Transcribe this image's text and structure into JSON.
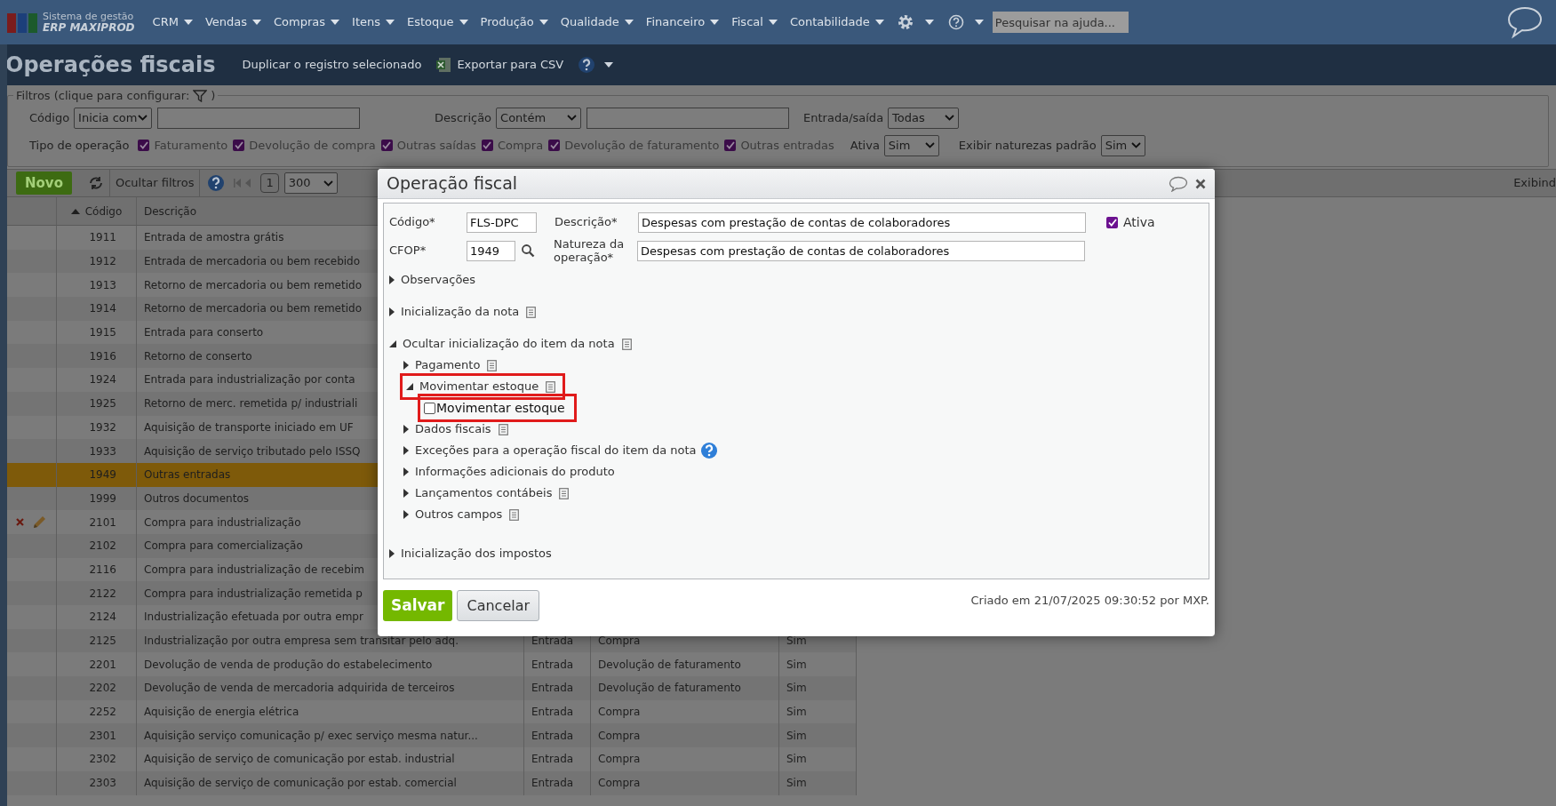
{
  "nav": {
    "logo_line1": "Sistema de gestão",
    "logo_line2": "ERP MAXIPROD",
    "menus": [
      "CRM",
      "Vendas",
      "Compras",
      "Itens",
      "Estoque",
      "Produção",
      "Qualidade",
      "Financeiro",
      "Fiscal",
      "Contabilidade"
    ],
    "search_placeholder": "Pesquisar na ajuda..."
  },
  "page": {
    "title": "Operações fiscais",
    "actions": [
      {
        "kind": "link",
        "label": "Duplicar o registro selecionado"
      },
      {
        "kind": "csv",
        "label": "Exportar para CSV"
      }
    ]
  },
  "filters": {
    "legend": "Filtros (clique para configurar:",
    "legend_end": ")",
    "row1": [
      {
        "label": "Código",
        "select": "Inicia com",
        "input": true
      },
      {
        "label": "Descrição",
        "select": "Contém",
        "input": true
      },
      {
        "label": "Entrada/saída",
        "select": "Todas",
        "input": false
      }
    ],
    "type_label": "Tipo de operação",
    "types": [
      {
        "label": "Faturamento",
        "checked": true
      },
      {
        "label": "Devolução de compra",
        "checked": true
      },
      {
        "label": "Outras saídas",
        "checked": true
      },
      {
        "label": "Compra",
        "checked": true
      },
      {
        "label": "Devolução de faturamento",
        "checked": true
      },
      {
        "label": "Outras entradas",
        "checked": true
      }
    ],
    "row2": [
      {
        "label": "Ativa",
        "select": "Sim"
      },
      {
        "label": "Exibir naturezas padrão",
        "select": "Sim"
      }
    ]
  },
  "toolbar": {
    "new": "Novo",
    "hide_filters": "Ocultar filtros",
    "page": "1",
    "per_page": "300",
    "showing": "Exibind"
  },
  "table": {
    "columns": [
      {
        "label": "Código",
        "sorted": true
      },
      {
        "label": "Descrição",
        "sorted": false
      }
    ],
    "rows": [
      {
        "code": "1911",
        "description": "Entrada de amostra grátis",
        "selected": false,
        "row_actions": false
      },
      {
        "code": "1912",
        "description": "Entrada de mercadoria ou bem recebido",
        "selected": false,
        "row_actions": false
      },
      {
        "code": "1913",
        "description": "Retorno de mercadoria ou bem remetido",
        "selected": false,
        "row_actions": false
      },
      {
        "code": "1914",
        "description": "Retorno de mercadoria ou bem remetido",
        "selected": false,
        "row_actions": false
      },
      {
        "code": "1915",
        "description": "Entrada para conserto",
        "selected": false,
        "row_actions": false
      },
      {
        "code": "1916",
        "description": "Retorno de conserto",
        "selected": false,
        "row_actions": false
      },
      {
        "code": "1924",
        "description": "Entrada para industrialização por conta",
        "selected": false,
        "row_actions": false
      },
      {
        "code": "1925",
        "description": "Retorno de merc. remetida p/ industriali",
        "selected": false,
        "row_actions": false
      },
      {
        "code": "1932",
        "description": "Aquisição de transporte iniciado em UF",
        "selected": false,
        "row_actions": false
      },
      {
        "code": "1933",
        "description": "Aquisição de serviço tributado pelo ISSQ",
        "selected": false,
        "row_actions": false
      },
      {
        "code": "1949",
        "description": "Outras entradas",
        "selected": true,
        "row_actions": false
      },
      {
        "code": "1999",
        "description": "Outros documentos",
        "selected": false,
        "row_actions": false
      },
      {
        "code": "2101",
        "description": "Compra para industrialização",
        "selected": false,
        "row_actions": true
      },
      {
        "code": "2102",
        "description": "Compra para comercialização",
        "selected": false,
        "row_actions": false
      },
      {
        "code": "2116",
        "description": "Compra para industrialização de recebim",
        "selected": false,
        "row_actions": false
      },
      {
        "code": "2122",
        "description": "Compra para industrialização remetida p",
        "selected": false,
        "row_actions": false
      },
      {
        "code": "2124",
        "description": "Industrialização efetuada por outra empr",
        "selected": false,
        "row_actions": false
      },
      {
        "code": "2125",
        "description": "Industrialização por outra empresa sem transitar pelo adq.",
        "column_3": "Entrada",
        "column_4": "Compra",
        "column_5": "Sim",
        "selected": false,
        "row_actions": false
      },
      {
        "code": "2201",
        "description": "Devolução de venda de produção do estabelecimento",
        "column_3": "Entrada",
        "column_4": "Devolução de faturamento",
        "column_5": "Sim",
        "selected": false,
        "row_actions": false
      },
      {
        "code": "2202",
        "description": "Devolução de venda de mercadoria adquirida de terceiros",
        "column_3": "Entrada",
        "column_4": "Devolução de faturamento",
        "column_5": "Sim",
        "selected": false,
        "row_actions": false
      },
      {
        "code": "2252",
        "description": "Aquisição de energia elétrica",
        "column_3": "Entrada",
        "column_4": "Compra",
        "column_5": "Sim",
        "selected": false,
        "row_actions": false
      },
      {
        "code": "2301",
        "description": "Aquisição serviço comunicação p/ exec serviço mesma natur...",
        "column_3": "Entrada",
        "column_4": "Compra",
        "column_5": "Sim",
        "selected": false,
        "row_actions": false
      },
      {
        "code": "2302",
        "description": "Aquisição de serviço de comunicação por estab. industrial",
        "column_3": "Entrada",
        "column_4": "Compra",
        "column_5": "Sim",
        "selected": false,
        "row_actions": false
      },
      {
        "code": "2303",
        "description": "Aquisição de serviço de comunicação por estab. comercial",
        "column_3": "Entrada",
        "column_4": "Compra",
        "column_5": "Sim",
        "selected": false,
        "row_actions": false
      }
    ]
  },
  "modal": {
    "title": "Operação fiscal",
    "code_label": "Código*",
    "code": "FLS-DPC",
    "description_label": "Descrição*",
    "description": "Despesas com prestação de contas de colaboradores",
    "active_label": "Ativa",
    "active": true,
    "cfop_label": "CFOP*",
    "cfop": "1949",
    "nature_label": "Natureza da operação*",
    "nature": "Despesas com prestação de contas de colaboradores",
    "tree": [
      {
        "kind": "section",
        "label": "Observações",
        "expanded": false,
        "doc": false
      },
      {
        "kind": "section",
        "label": "Inicialização da nota",
        "expanded": false,
        "doc": true
      },
      {
        "kind": "section",
        "label": "Ocultar inicialização do item da nota",
        "expanded": true,
        "doc": true,
        "children": [
          {
            "kind": "section",
            "label": "Pagamento",
            "expanded": false,
            "doc": true
          },
          {
            "kind": "section",
            "label": "Movimentar estoque",
            "expanded": true,
            "doc": true,
            "highlighted": true,
            "children": [
              {
                "kind": "checkbox",
                "label": "Movimentar estoque",
                "checked": false,
                "highlighted": true
              }
            ]
          },
          {
            "kind": "section",
            "label": "Dados fiscais",
            "expanded": false,
            "doc": true
          },
          {
            "kind": "section",
            "label": "Exceções para a operação fiscal do item da nota",
            "expanded": false,
            "doc": false,
            "help": true
          },
          {
            "kind": "section",
            "label": "Informações adicionais do produto",
            "expanded": false,
            "doc": false
          },
          {
            "kind": "section",
            "label": "Lançamentos contábeis",
            "expanded": false,
            "doc": true
          },
          {
            "kind": "section",
            "label": "Outros campos",
            "expanded": false,
            "doc": true
          }
        ]
      },
      {
        "kind": "section",
        "label": "Inicialização dos impostos",
        "expanded": false,
        "doc": false
      }
    ],
    "save": "Salvar",
    "cancel": "Cancelar",
    "created": "Criado em 21/07/2025 09:30:52 por MXP."
  }
}
